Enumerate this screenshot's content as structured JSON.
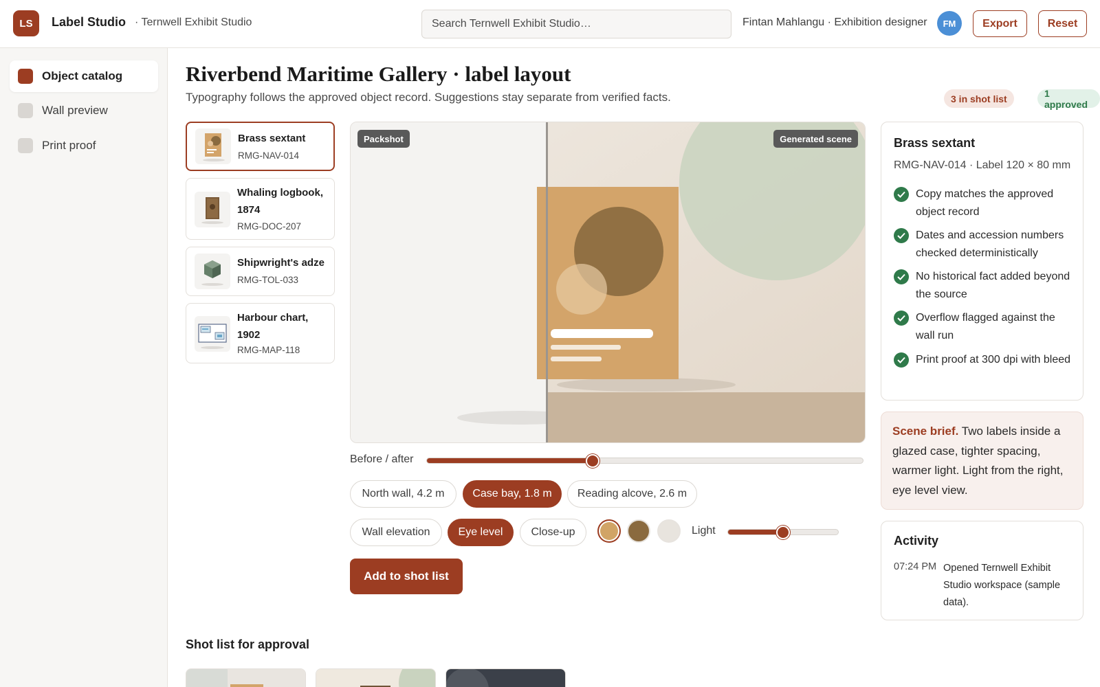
{
  "header": {
    "logo_text": "LS",
    "app_name": "Label Studio",
    "workspace": "· Ternwell Exhibit Studio",
    "search_placeholder": "Search Ternwell Exhibit Studio…",
    "user_label": "Fintan Mahlangu · Exhibition designer",
    "avatar_initials": "FM",
    "export_label": "Export",
    "reset_label": "Reset"
  },
  "sidebar": {
    "items": [
      {
        "label": "Object catalog",
        "active": true
      },
      {
        "label": "Wall preview",
        "active": false
      },
      {
        "label": "Print proof",
        "active": false
      }
    ]
  },
  "main": {
    "title": "Riverbend Maritime Gallery · label layout",
    "subtitle": "Typography follows the approved object record. Suggestions stay separate from verified facts.",
    "badges": {
      "shot_list": "3 in shot list",
      "approved": "1 approved"
    }
  },
  "objects": [
    {
      "name": "Brass sextant",
      "id": "RMG-NAV-014",
      "icon": "sextant-thumb-icon",
      "selected": true
    },
    {
      "name": "Whaling logbook, 1874",
      "id": "RMG-DOC-207",
      "icon": "logbook-thumb-icon",
      "selected": false
    },
    {
      "name": "Shipwright's adze",
      "id": "RMG-TOL-033",
      "icon": "adze-cube-icon",
      "selected": false
    },
    {
      "name": "Harbour chart, 1902",
      "id": "RMG-MAP-118",
      "icon": "chart-map-icon",
      "selected": false
    }
  ],
  "preview": {
    "tag_left": "Packshot",
    "tag_right": "Generated scene",
    "slider_label": "Before / after",
    "before_after_fraction": 0.38
  },
  "locations": [
    {
      "label": "North wall, 4.2 m",
      "active": false
    },
    {
      "label": "Case bay, 1.8 m",
      "active": true
    },
    {
      "label": "Reading alcove, 2.6 m",
      "active": false
    }
  ],
  "views": [
    {
      "label": "Wall elevation",
      "active": false
    },
    {
      "label": "Eye level",
      "active": true
    },
    {
      "label": "Close-up",
      "active": false
    }
  ],
  "swatches": [
    {
      "color": "#d1a466",
      "active": true
    },
    {
      "color": "#8a6a3f",
      "active": false
    },
    {
      "color": "#e8e4de",
      "active": false
    }
  ],
  "light": {
    "label": "Light",
    "fraction": 0.5
  },
  "actions": {
    "add_to_shot_list": "Add to shot list"
  },
  "shot_list": {
    "title": "Shot list for approval"
  },
  "detail": {
    "title": "Brass sextant",
    "meta": "RMG-NAV-014 · Label 120 × 80 mm",
    "checks": [
      "Copy matches the approved object record",
      "Dates and accession numbers checked deterministically",
      "No historical fact added beyond the source",
      "Overflow flagged against the wall run",
      "Print proof at 300 dpi with bleed"
    ]
  },
  "brief": {
    "lead": "Scene brief.",
    "text": " Two labels inside a glazed case, tighter spacing, warmer light. Light from the right, eye level view."
  },
  "activity": {
    "title": "Activity",
    "entries": [
      {
        "time": "07:24 PM",
        "text": "Opened Ternwell Exhibit Studio workspace (sample data)."
      }
    ]
  },
  "colors": {
    "accent": "#9c3d22",
    "success": "#2f7a4a",
    "avatar": "#4b8fd6"
  }
}
